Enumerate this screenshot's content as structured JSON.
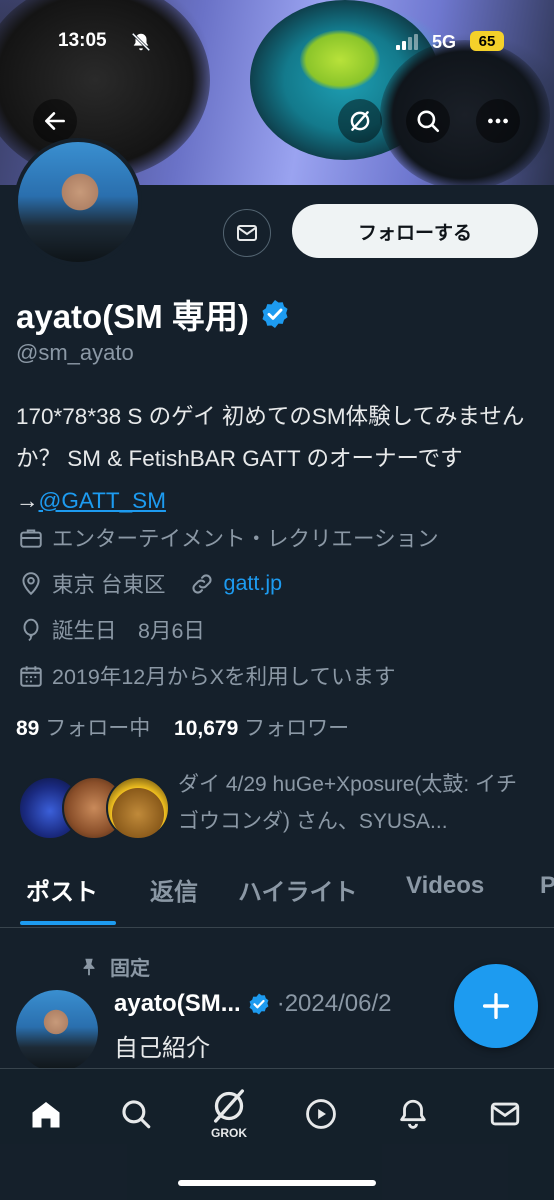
{
  "status_bar": {
    "time": "13:05",
    "network": "5G",
    "battery": "65"
  },
  "profile": {
    "name": "ayato(SM 専用)",
    "handle": "@sm_ayato",
    "verified": true,
    "follow_button": "フォローする",
    "bio_text": "170*78*38 S のゲイ 初めてのSM体験してみませんか？ SM & FetishBAR GATT のオーナーです →",
    "bio_link": "@GATT_SM",
    "category": "エンターテイメント・レクリエーション",
    "location": "東京 台東区",
    "website": "gatt.jp",
    "birthday": "誕生日　8月6日",
    "joined": "2019年12月からXを利用しています",
    "following_count": "89",
    "following_label": "フォロー中",
    "followers_count": "10,679",
    "followers_label": "フォロワー",
    "followed_by": "ダイ 4/29 huGe+Xposure(太鼓: イチゴウコンダ) さん、SYUSA..."
  },
  "tabs": [
    "ポスト",
    "返信",
    "ハイライト",
    "Videos",
    "P"
  ],
  "pinned_post": {
    "pinned_label": "固定",
    "author": "ayato(SM...",
    "date": "·2024/06/2",
    "text": "自己紹介"
  },
  "bottom_nav": {
    "grok_label": "GROK"
  },
  "colors": {
    "background": "#15202b",
    "accent": "#1d9bf0",
    "secondary_text": "#8b98a5"
  }
}
